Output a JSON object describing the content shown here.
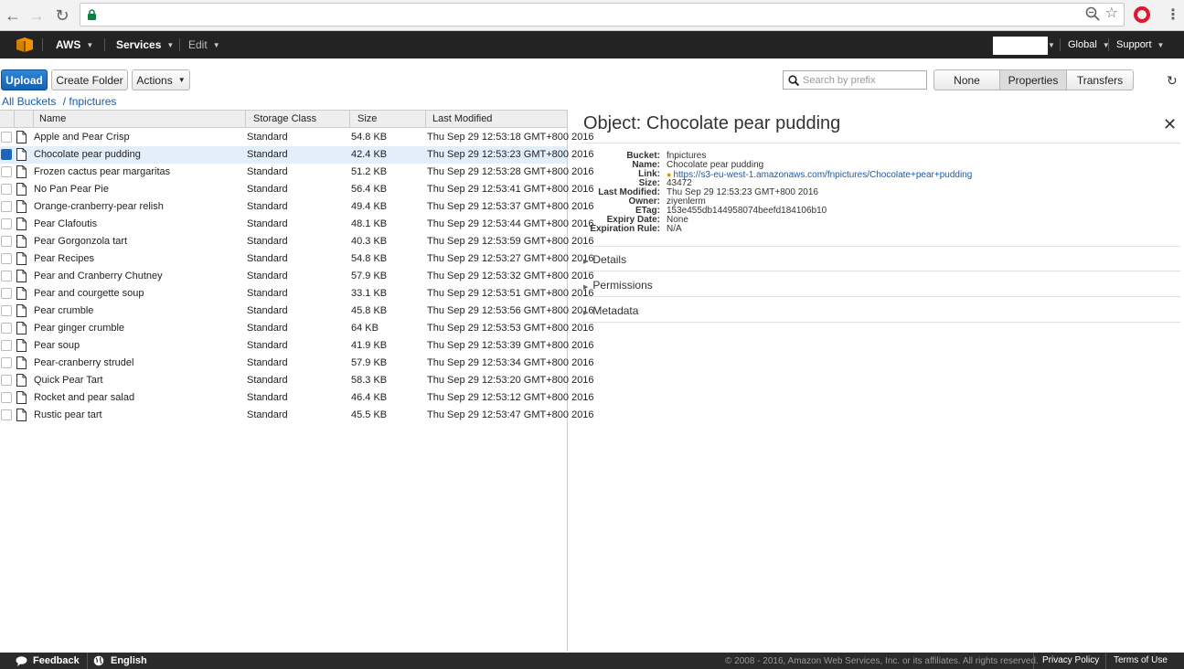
{
  "aws_nav": {
    "brand": "AWS",
    "services": "Services",
    "edit": "Edit",
    "region": "Global",
    "support": "Support"
  },
  "toolbar": {
    "upload": "Upload",
    "create_folder": "Create Folder",
    "actions": "Actions",
    "search_placeholder": "Search by prefix",
    "view_none": "None",
    "view_properties": "Properties",
    "view_transfers": "Transfers",
    "active_view": "Properties"
  },
  "breadcrumb": {
    "root": "All Buckets",
    "bucket": "/ fnpictures"
  },
  "table": {
    "headers": [
      "Name",
      "Storage Class",
      "Size",
      "Last Modified"
    ],
    "rows": [
      {
        "name": "Apple and Pear Crisp",
        "storage": "Standard",
        "size": "54.8 KB",
        "modified": "Thu Sep 29 12:53:18 GMT+800 2016",
        "selected": false
      },
      {
        "name": "Chocolate pear pudding",
        "storage": "Standard",
        "size": "42.4 KB",
        "modified": "Thu Sep 29 12:53:23 GMT+800 2016",
        "selected": true
      },
      {
        "name": "Frozen cactus pear margaritas",
        "storage": "Standard",
        "size": "51.2 KB",
        "modified": "Thu Sep 29 12:53:28 GMT+800 2016",
        "selected": false
      },
      {
        "name": "No Pan Pear Pie",
        "storage": "Standard",
        "size": "56.4 KB",
        "modified": "Thu Sep 29 12:53:41 GMT+800 2016",
        "selected": false
      },
      {
        "name": "Orange-cranberry-pear relish",
        "storage": "Standard",
        "size": "49.4 KB",
        "modified": "Thu Sep 29 12:53:37 GMT+800 2016",
        "selected": false
      },
      {
        "name": "Pear Clafoutis",
        "storage": "Standard",
        "size": "48.1 KB",
        "modified": "Thu Sep 29 12:53:44 GMT+800 2016",
        "selected": false
      },
      {
        "name": "Pear Gorgonzola tart",
        "storage": "Standard",
        "size": "40.3 KB",
        "modified": "Thu Sep 29 12:53:59 GMT+800 2016",
        "selected": false
      },
      {
        "name": "Pear Recipes",
        "storage": "Standard",
        "size": "54.8 KB",
        "modified": "Thu Sep 29 12:53:27 GMT+800 2016",
        "selected": false
      },
      {
        "name": "Pear and Cranberry Chutney",
        "storage": "Standard",
        "size": "57.9 KB",
        "modified": "Thu Sep 29 12:53:32 GMT+800 2016",
        "selected": false
      },
      {
        "name": "Pear and courgette soup",
        "storage": "Standard",
        "size": "33.1 KB",
        "modified": "Thu Sep 29 12:53:51 GMT+800 2016",
        "selected": false
      },
      {
        "name": "Pear crumble",
        "storage": "Standard",
        "size": "45.8 KB",
        "modified": "Thu Sep 29 12:53:56 GMT+800 2016",
        "selected": false
      },
      {
        "name": "Pear ginger crumble",
        "storage": "Standard",
        "size": "64 KB",
        "modified": "Thu Sep 29 12:53:53 GMT+800 2016",
        "selected": false
      },
      {
        "name": "Pear soup",
        "storage": "Standard",
        "size": "41.9 KB",
        "modified": "Thu Sep 29 12:53:39 GMT+800 2016",
        "selected": false
      },
      {
        "name": "Pear-cranberry strudel",
        "storage": "Standard",
        "size": "57.9 KB",
        "modified": "Thu Sep 29 12:53:34 GMT+800 2016",
        "selected": false
      },
      {
        "name": "Quick Pear Tart",
        "storage": "Standard",
        "size": "58.3 KB",
        "modified": "Thu Sep 29 12:53:20 GMT+800 2016",
        "selected": false
      },
      {
        "name": "Rocket and pear salad",
        "storage": "Standard",
        "size": "46.4 KB",
        "modified": "Thu Sep 29 12:53:12 GMT+800 2016",
        "selected": false
      },
      {
        "name": "Rustic pear tart",
        "storage": "Standard",
        "size": "45.5 KB",
        "modified": "Thu Sep 29 12:53:47 GMT+800 2016",
        "selected": false
      }
    ]
  },
  "panel": {
    "title": "Object: Chocolate pear pudding",
    "properties": [
      {
        "key": "Bucket:",
        "value": "fnpictures"
      },
      {
        "key": "Name:",
        "value": "Chocolate pear pudding"
      },
      {
        "key": "Link:",
        "value": "https://s3-eu-west-1.amazonaws.com/fnpictures/Chocolate+pear+pudding"
      },
      {
        "key": "Size:",
        "value": "43472"
      },
      {
        "key": "Last Modified:",
        "value": "Thu Sep 29 12:53:23 GMT+800 2016"
      },
      {
        "key": "Owner:",
        "value": "ziyenlerm"
      },
      {
        "key": "ETag:",
        "value": "153e455db144958074beefd184106b10"
      },
      {
        "key": "Expiry Date:",
        "value": "None"
      },
      {
        "key": "Expiration Rule:",
        "value": "N/A"
      }
    ],
    "sections": [
      "Details",
      "Permissions",
      "Metadata"
    ]
  },
  "footer": {
    "feedback": "Feedback",
    "language": "English",
    "copyright": "© 2008 - 2016, Amazon Web Services, Inc. or its affiliates. All rights reserved.",
    "privacy": "Privacy Policy",
    "terms": "Terms of Use"
  },
  "colors": {
    "nav_bg": "#232323",
    "primary_button": "#1f6fc5",
    "selected_row": "#e3eefb",
    "link": "#1a5aa8"
  }
}
